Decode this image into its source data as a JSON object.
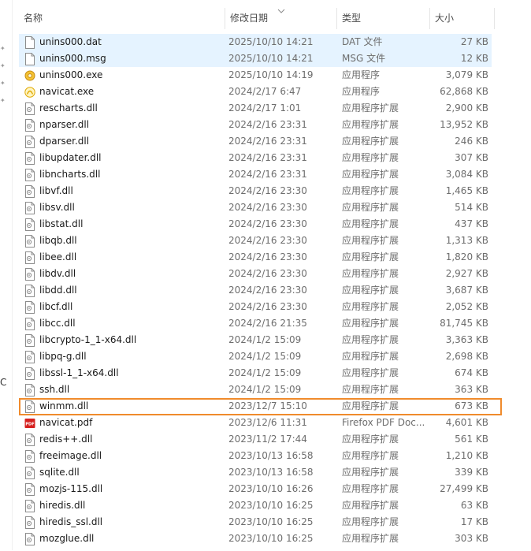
{
  "columns": {
    "name": "名称",
    "date": "修改日期",
    "type": "类型",
    "size": "大小"
  },
  "left_stray_text": "C",
  "files": [
    {
      "name": "unins000.dat",
      "date": "2025/10/10 14:21",
      "type": "DAT 文件",
      "size": "27 KB",
      "icon": "document-icon"
    },
    {
      "name": "unins000.msg",
      "date": "2025/10/10 14:21",
      "type": "MSG 文件",
      "size": "12 KB",
      "icon": "document-icon"
    },
    {
      "name": "unins000.exe",
      "date": "2025/10/10 14:19",
      "type": "应用程序",
      "size": "3,079 KB",
      "icon": "installer-icon"
    },
    {
      "name": "navicat.exe",
      "date": "2024/2/17 6:47",
      "type": "应用程序",
      "size": "62,868 KB",
      "icon": "navicat-icon"
    },
    {
      "name": "rescharts.dll",
      "date": "2024/2/17 1:01",
      "type": "应用程序扩展",
      "size": "2,900 KB",
      "icon": "dll-icon"
    },
    {
      "name": "nparser.dll",
      "date": "2024/2/16 23:31",
      "type": "应用程序扩展",
      "size": "13,952 KB",
      "icon": "dll-icon"
    },
    {
      "name": "dparser.dll",
      "date": "2024/2/16 23:31",
      "type": "应用程序扩展",
      "size": "246 KB",
      "icon": "dll-icon"
    },
    {
      "name": "libupdater.dll",
      "date": "2024/2/16 23:31",
      "type": "应用程序扩展",
      "size": "307 KB",
      "icon": "dll-icon"
    },
    {
      "name": "libncharts.dll",
      "date": "2024/2/16 23:31",
      "type": "应用程序扩展",
      "size": "3,084 KB",
      "icon": "dll-icon"
    },
    {
      "name": "libvf.dll",
      "date": "2024/2/16 23:30",
      "type": "应用程序扩展",
      "size": "1,465 KB",
      "icon": "dll-icon"
    },
    {
      "name": "libsv.dll",
      "date": "2024/2/16 23:30",
      "type": "应用程序扩展",
      "size": "514 KB",
      "icon": "dll-icon"
    },
    {
      "name": "libstat.dll",
      "date": "2024/2/16 23:30",
      "type": "应用程序扩展",
      "size": "437 KB",
      "icon": "dll-icon"
    },
    {
      "name": "libqb.dll",
      "date": "2024/2/16 23:30",
      "type": "应用程序扩展",
      "size": "1,313 KB",
      "icon": "dll-icon"
    },
    {
      "name": "libee.dll",
      "date": "2024/2/16 23:30",
      "type": "应用程序扩展",
      "size": "1,820 KB",
      "icon": "dll-icon"
    },
    {
      "name": "libdv.dll",
      "date": "2024/2/16 23:30",
      "type": "应用程序扩展",
      "size": "2,927 KB",
      "icon": "dll-icon"
    },
    {
      "name": "libdd.dll",
      "date": "2024/2/16 23:30",
      "type": "应用程序扩展",
      "size": "3,687 KB",
      "icon": "dll-icon"
    },
    {
      "name": "libcf.dll",
      "date": "2024/2/16 23:30",
      "type": "应用程序扩展",
      "size": "2,052 KB",
      "icon": "dll-icon"
    },
    {
      "name": "libcc.dll",
      "date": "2024/2/16 21:35",
      "type": "应用程序扩展",
      "size": "81,745 KB",
      "icon": "dll-icon"
    },
    {
      "name": "libcrypto-1_1-x64.dll",
      "date": "2024/1/2 15:09",
      "type": "应用程序扩展",
      "size": "3,363 KB",
      "icon": "dll-icon"
    },
    {
      "name": "libpq-g.dll",
      "date": "2024/1/2 15:09",
      "type": "应用程序扩展",
      "size": "2,698 KB",
      "icon": "dll-icon"
    },
    {
      "name": "libssl-1_1-x64.dll",
      "date": "2024/1/2 15:09",
      "type": "应用程序扩展",
      "size": "674 KB",
      "icon": "dll-icon"
    },
    {
      "name": "ssh.dll",
      "date": "2024/1/2 15:09",
      "type": "应用程序扩展",
      "size": "363 KB",
      "icon": "dll-icon"
    },
    {
      "name": "winmm.dll",
      "date": "2023/12/7 15:10",
      "type": "应用程序扩展",
      "size": "673 KB",
      "icon": "dll-icon",
      "highlighted": true
    },
    {
      "name": "navicat.pdf",
      "date": "2023/12/6 11:31",
      "type": "Firefox PDF Doc...",
      "size": "4,601 KB",
      "icon": "pdf-icon"
    },
    {
      "name": "redis++.dll",
      "date": "2023/11/2 17:44",
      "type": "应用程序扩展",
      "size": "561 KB",
      "icon": "dll-icon"
    },
    {
      "name": "freeimage.dll",
      "date": "2023/10/13 16:58",
      "type": "应用程序扩展",
      "size": "1,210 KB",
      "icon": "dll-icon"
    },
    {
      "name": "sqlite.dll",
      "date": "2023/10/13 16:58",
      "type": "应用程序扩展",
      "size": "339 KB",
      "icon": "dll-icon"
    },
    {
      "name": "mozjs-115.dll",
      "date": "2023/10/10 16:26",
      "type": "应用程序扩展",
      "size": "27,499 KB",
      "icon": "dll-icon"
    },
    {
      "name": "hiredis.dll",
      "date": "2023/10/10 16:25",
      "type": "应用程序扩展",
      "size": "63 KB",
      "icon": "dll-icon"
    },
    {
      "name": "hiredis_ssl.dll",
      "date": "2023/10/10 16:25",
      "type": "应用程序扩展",
      "size": "17 KB",
      "icon": "dll-icon"
    },
    {
      "name": "mozglue.dll",
      "date": "2023/10/10 16:25",
      "type": "应用程序扩展",
      "size": "303 KB",
      "icon": "dll-icon"
    }
  ],
  "colors": {
    "selection": "#e5f3ff",
    "highlight_border": "#f08b2c",
    "secondary_text": "#6d6d6d"
  }
}
